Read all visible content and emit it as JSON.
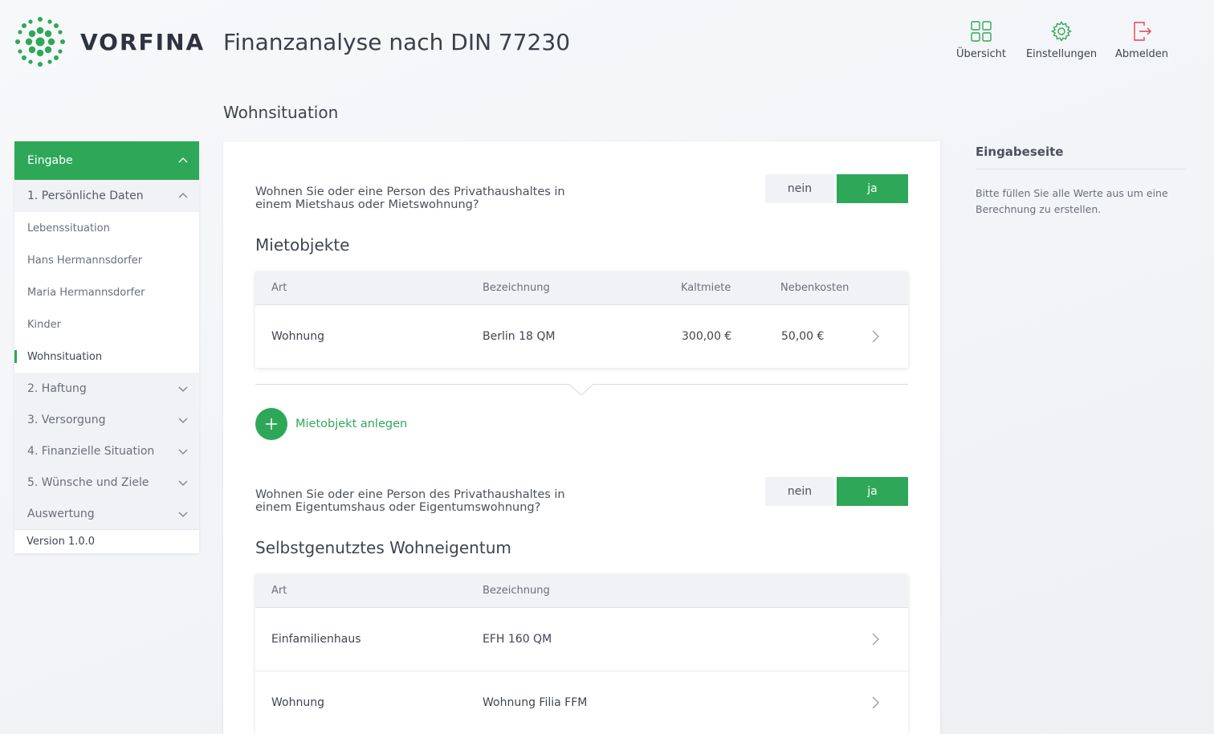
{
  "brand": {
    "name": "VORFINA",
    "accent": "#2ea858"
  },
  "header": {
    "title": "Finanzanalyse nach DIN 77230",
    "actions": [
      {
        "label": "Übersicht",
        "icon": "grid-icon"
      },
      {
        "label": "Einstellungen",
        "icon": "gear-icon"
      },
      {
        "label": "Abmelden",
        "icon": "logout-icon"
      }
    ]
  },
  "page": {
    "title": "Wohnsituation"
  },
  "sidebar": {
    "head": "Eingabe",
    "section": "1. Persönliche Daten",
    "items": [
      "Lebenssituation",
      "Hans Hermannsdorfer",
      "Maria Hermannsdorfer",
      "Kinder",
      "Wohnsituation"
    ],
    "active": "Wohnsituation",
    "groups": [
      "2. Haftung",
      "3. Versorgung",
      "4. Finanzielle Situation",
      "5. Wünsche und Ziele",
      "Auswertung"
    ],
    "version": "Version 1.0.0"
  },
  "main": {
    "q1": {
      "text": "Wohnen Sie oder eine Person des Privathaushaltes in einem Mietshaus oder Mietswohnung?",
      "no": "nein",
      "yes": "ja",
      "selected": "ja"
    },
    "rent": {
      "title": "Mietobjekte",
      "columns": [
        "Art",
        "Bezeichnung",
        "Kaltmiete",
        "Nebenkosten"
      ],
      "rows": [
        {
          "art": "Wohnung",
          "bezeichnung": "Berlin 18 QM",
          "kaltmiete": "300,00 €",
          "nebenkosten": "50,00 €"
        }
      ],
      "add_label": "Mietobjekt anlegen"
    },
    "q2": {
      "text": "Wohnen Sie oder eine Person des Privathaushaltes in einem Eigentumshaus oder Eigentumswohnung?",
      "no": "nein",
      "yes": "ja",
      "selected": "ja"
    },
    "own": {
      "title": "Selbstgenutztes Wohneigentum",
      "columns": [
        "Art",
        "Bezeichnung"
      ],
      "rows": [
        {
          "art": "Einfamilienhaus",
          "bezeichnung": "EFH 160 QM"
        },
        {
          "art": "Wohnung",
          "bezeichnung": "Wohnung Filia FFM"
        }
      ]
    }
  },
  "info": {
    "title": "Eingabeseite",
    "text": "Bitte füllen Sie alle Werte aus um eine Berechnung zu erstellen."
  }
}
